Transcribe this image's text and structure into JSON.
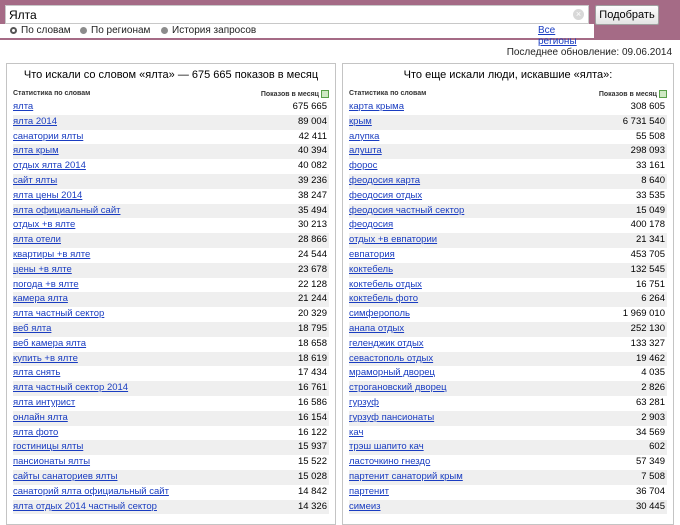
{
  "search": {
    "query": "Ялта",
    "submit_label": "Подобрать",
    "clear_label": "×"
  },
  "modes": [
    {
      "label": "По словам",
      "active": true
    },
    {
      "label": "По регионам",
      "active": false
    },
    {
      "label": "История запросов",
      "active": false
    }
  ],
  "all_regions_label": "Все регионы",
  "last_update": "Последнее обновление: 09.06.2014",
  "left": {
    "title": "Что искали со словом «ялта» — 675 665 показов в месяц",
    "col_left": "Статистика по словам",
    "col_right": "Показов в месяц",
    "rows": [
      {
        "phrase": "ялта",
        "count": "675 665"
      },
      {
        "phrase": "ялта 2014",
        "count": "89 004"
      },
      {
        "phrase": "санатории ялты",
        "count": "42 411"
      },
      {
        "phrase": "ялта крым",
        "count": "40 394"
      },
      {
        "phrase": "отдых ялта 2014",
        "count": "40 082"
      },
      {
        "phrase": "сайт ялты",
        "count": "39 236"
      },
      {
        "phrase": "ялта цены 2014",
        "count": "38 247"
      },
      {
        "phrase": "ялта официальный сайт",
        "count": "35 494"
      },
      {
        "phrase": "отдых +в ялте",
        "count": "30 213"
      },
      {
        "phrase": "ялта отели",
        "count": "28 866"
      },
      {
        "phrase": "квартиры +в ялте",
        "count": "24 544"
      },
      {
        "phrase": "цены +в ялте",
        "count": "23 678"
      },
      {
        "phrase": "погода +в ялте",
        "count": "22 128"
      },
      {
        "phrase": "камера ялта",
        "count": "21 244"
      },
      {
        "phrase": "ялта частный сектор",
        "count": "20 329"
      },
      {
        "phrase": "веб ялта",
        "count": "18 795"
      },
      {
        "phrase": "веб камера ялта",
        "count": "18 658"
      },
      {
        "phrase": "купить +в ялте",
        "count": "18 619"
      },
      {
        "phrase": "ялта снять",
        "count": "17 434"
      },
      {
        "phrase": "ялта частный сектор 2014",
        "count": "16 761"
      },
      {
        "phrase": "ялта интурист",
        "count": "16 586"
      },
      {
        "phrase": "онлайн ялта",
        "count": "16 154"
      },
      {
        "phrase": "ялта фото",
        "count": "16 122"
      },
      {
        "phrase": "гостиницы ялты",
        "count": "15 937"
      },
      {
        "phrase": "пансионаты ялты",
        "count": "15 522"
      },
      {
        "phrase": "сайты санаториев ялты",
        "count": "15 028"
      },
      {
        "phrase": "санаторий ялта официальный сайт",
        "count": "14 842"
      },
      {
        "phrase": "ялта отдых 2014 частный сектор",
        "count": "14 326"
      }
    ]
  },
  "right": {
    "title": "Что еще искали люди, искавшие «ялта»:",
    "col_left": "Статистика по словам",
    "col_right": "Показов в месяц",
    "rows": [
      {
        "phrase": "карта крыма",
        "count": "308 605"
      },
      {
        "phrase": "крым",
        "count": "6 731 540"
      },
      {
        "phrase": "алупка",
        "count": "55 508"
      },
      {
        "phrase": "алушта",
        "count": "298 093"
      },
      {
        "phrase": "форос",
        "count": "33 161"
      },
      {
        "phrase": "феодосия карта",
        "count": "8 640"
      },
      {
        "phrase": "феодосия отдых",
        "count": "33 535"
      },
      {
        "phrase": "феодосия частный сектор",
        "count": "15 049"
      },
      {
        "phrase": "феодосия",
        "count": "400 178"
      },
      {
        "phrase": "отдых +в евпатории",
        "count": "21 341"
      },
      {
        "phrase": "евпатория",
        "count": "453 705"
      },
      {
        "phrase": "коктебель",
        "count": "132 545"
      },
      {
        "phrase": "коктебель отдых",
        "count": "16 751"
      },
      {
        "phrase": "коктебель фото",
        "count": "6 264"
      },
      {
        "phrase": "симферополь",
        "count": "1 969 010"
      },
      {
        "phrase": "анапа отдых",
        "count": "252 130"
      },
      {
        "phrase": "геленджик отдых",
        "count": "133 327"
      },
      {
        "phrase": "севастополь отдых",
        "count": "19 462"
      },
      {
        "phrase": "мраморный дворец",
        "count": "4 035"
      },
      {
        "phrase": "строгановский дворец",
        "count": "2 826"
      },
      {
        "phrase": "гурзуф",
        "count": "63 281"
      },
      {
        "phrase": "гурзуф пансионаты",
        "count": "2 903"
      },
      {
        "phrase": "кач",
        "count": "34 569"
      },
      {
        "phrase": "трэш шапито кач",
        "count": "602"
      },
      {
        "phrase": "ласточкино гнездо",
        "count": "57 349"
      },
      {
        "phrase": "партенит санаторий крым",
        "count": "7 508"
      },
      {
        "phrase": "партенит",
        "count": "36 704"
      },
      {
        "phrase": "симеиз",
        "count": "30 445"
      }
    ]
  }
}
